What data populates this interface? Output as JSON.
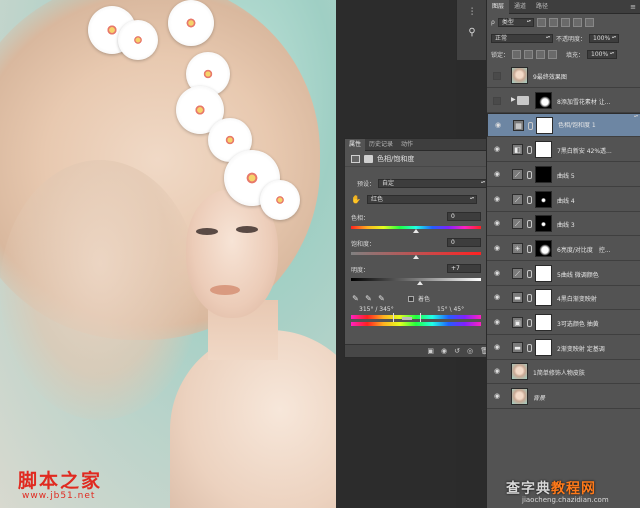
{
  "watermark_left": {
    "title": "脚本之家",
    "url": "www.jb51.net"
  },
  "watermark_right": {
    "title": "查字典",
    "title_accent": "教程网",
    "url": "jiaocheng.chazidian.com"
  },
  "properties": {
    "tabs": [
      "属性",
      "历史记录",
      "动作"
    ],
    "active_tab": 0,
    "adjustment_title": "色相/饱和度",
    "preset_label": "预设：",
    "preset_value": "自定",
    "channel_value": "红色",
    "hue_label": "色相：",
    "hue_value": "0",
    "saturation_label": "饱和度：",
    "saturation_value": "0",
    "lightness_label": "明度：",
    "lightness_value": "+7",
    "colorize_label": "着色",
    "range_left": "315° / 345°",
    "range_right": "15° \\ 45°",
    "menu_icon": "≡"
  },
  "layers": {
    "tabs": [
      "图层",
      "通道",
      "路径"
    ],
    "active_tab": 0,
    "filter_kind": "类型",
    "blend_mode": "正常",
    "opacity_label": "不透明度：",
    "opacity_value": "100%",
    "lock_label": "锁定：",
    "fill_label": "填充：",
    "fill_value": "100%",
    "items": [
      {
        "name": "9最终效果图",
        "type": "photo",
        "visible": false,
        "selected": false
      },
      {
        "name": "8添加雪花素材 让...",
        "type": "group",
        "visible": false,
        "selected": false
      },
      {
        "name": "色相/饱和度 1",
        "type": "adjust",
        "icon": "▦",
        "mask": "white",
        "visible": true,
        "selected": true
      },
      {
        "name": "7黑白新安 42%透...",
        "type": "adjust",
        "icon": "◧",
        "mask": "white",
        "visible": true,
        "selected": false
      },
      {
        "name": "曲线 5",
        "type": "adjust",
        "icon": "⟋",
        "mask": "black",
        "visible": true,
        "selected": false
      },
      {
        "name": "曲线 4",
        "type": "adjust",
        "icon": "⟋",
        "mask": "dots",
        "visible": true,
        "selected": false
      },
      {
        "name": "曲线 3",
        "type": "adjust",
        "icon": "⟋",
        "mask": "dots",
        "visible": true,
        "selected": false
      },
      {
        "name": "6亮度/对比度　控...",
        "type": "adjust",
        "icon": "☀",
        "mask": "partial",
        "visible": true,
        "selected": false
      },
      {
        "name": "5曲线  微调颜色",
        "type": "adjust",
        "icon": "⟋",
        "mask": "white",
        "visible": true,
        "selected": false
      },
      {
        "name": "4黑白渐变映射",
        "type": "adjust",
        "icon": "▬",
        "mask": "white",
        "visible": true,
        "selected": false
      },
      {
        "name": "3可选颜色  抽黄",
        "type": "adjust",
        "icon": "▣",
        "mask": "white",
        "visible": true,
        "selected": false
      },
      {
        "name": "2渐变映射 定基调",
        "type": "adjust",
        "icon": "▬",
        "mask": "white",
        "visible": true,
        "selected": false
      },
      {
        "name": "1简单修饰人物皮肤",
        "type": "photo",
        "visible": true,
        "selected": false
      },
      {
        "name": "背景",
        "type": "photo",
        "visible": true,
        "selected": false,
        "italic": true
      }
    ]
  }
}
